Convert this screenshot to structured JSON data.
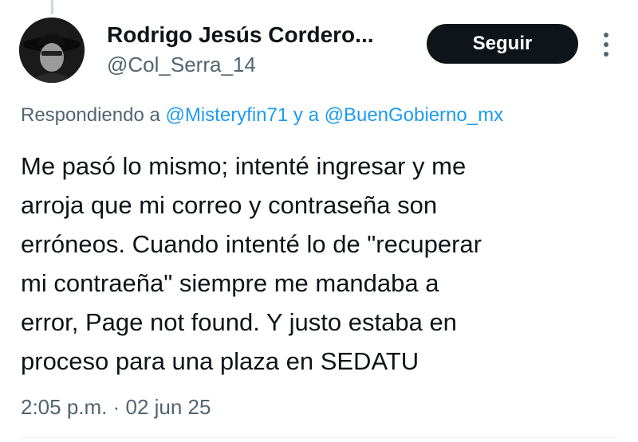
{
  "author": {
    "display_name": "Rodrigo Jesús Cordero...",
    "handle": "@Col_Serra_14",
    "avatar_icon": "profile-photo"
  },
  "actions": {
    "follow_label": "Seguir",
    "more_icon": "more-vertical-icon"
  },
  "reply_context": {
    "prefix": "Respondiendo a",
    "mention_1": "@Misteryfin71",
    "connector": "y a",
    "mention_2": "@BuenGobierno_mx"
  },
  "tweet": {
    "lines": [
      "Me pasó lo mismo; intenté ingresar y me",
      "arroja que mi correo y contraseña son",
      "erróneos. Cuando intenté lo de \"recuperar",
      "mi contraeña\" siempre me mandaba a",
      "error, Page not found. Y justo estaba en",
      "proceso para una plaza en SEDATU"
    ],
    "timestamp": "2:05 p.m. · 02 jun 25"
  },
  "colors": {
    "link": "#1d9bf0",
    "secondary_text": "#536471",
    "primary_text": "#0f1419",
    "button_bg": "#0f1419"
  }
}
